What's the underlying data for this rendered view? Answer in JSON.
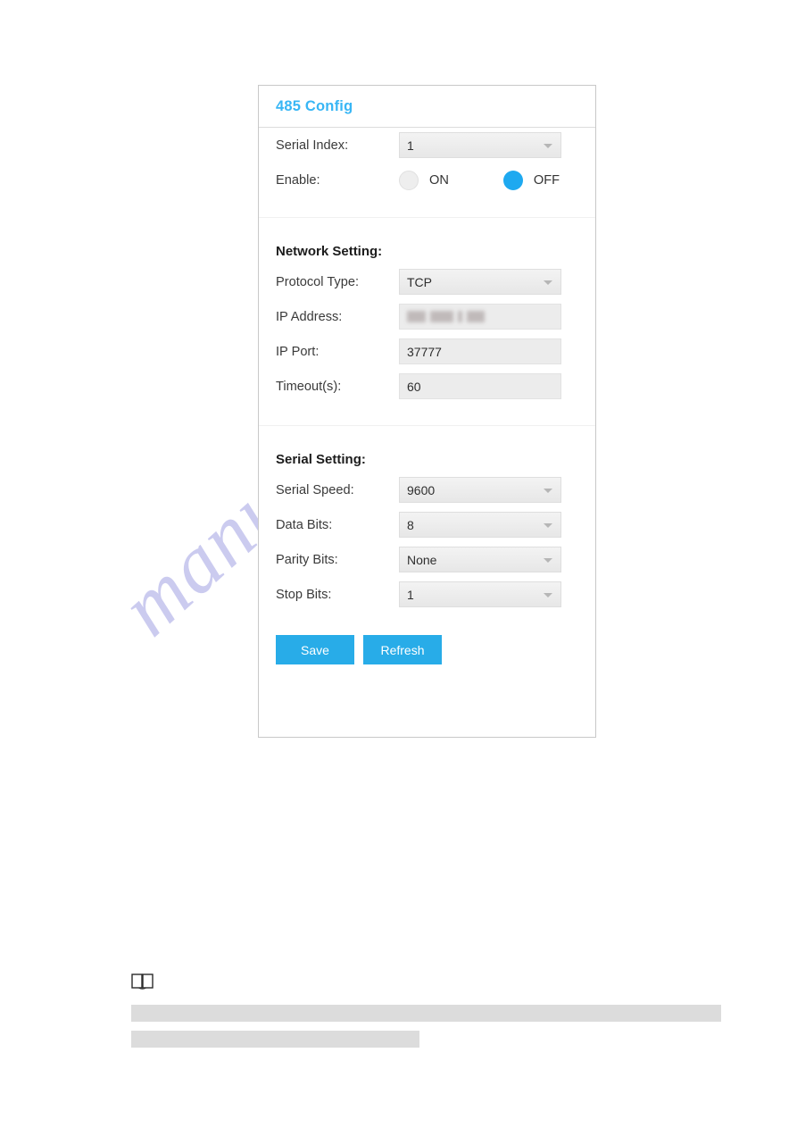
{
  "panel": {
    "title": "485 Config",
    "top_section": {
      "rows": [
        {
          "label": "Serial Index:",
          "value": "1",
          "control": "select"
        }
      ],
      "enable": {
        "label": "Enable:",
        "options": [
          {
            "label": "ON",
            "selected": false
          },
          {
            "label": "OFF",
            "selected": true
          }
        ]
      }
    },
    "network_section": {
      "title": "Network Setting:",
      "rows": [
        {
          "label": "Protocol Type:",
          "value": "TCP",
          "control": "select"
        },
        {
          "label": "IP Address:",
          "value": "",
          "control": "text",
          "redacted": true
        },
        {
          "label": "IP Port:",
          "value": "37777",
          "control": "text"
        },
        {
          "label": "Timeout(s):",
          "value": "60",
          "control": "text"
        }
      ]
    },
    "serial_section": {
      "title": "Serial Setting:",
      "rows": [
        {
          "label": "Serial Speed:",
          "value": "9600",
          "control": "select"
        },
        {
          "label": "Data Bits:",
          "value": "8",
          "control": "select"
        },
        {
          "label": "Parity Bits:",
          "value": "None",
          "control": "select"
        },
        {
          "label": "Stop Bits:",
          "value": "1",
          "control": "select"
        }
      ]
    },
    "buttons": {
      "save": "Save",
      "refresh": "Refresh"
    }
  },
  "note": {
    "icon": "book-icon",
    "bars": [
      "",
      ""
    ]
  },
  "watermark": {
    "text": "manualshive.com"
  },
  "colors": {
    "accent": "#38b6f5",
    "button": "#28ace8",
    "radio_selected": "#1ea9f0",
    "field_bg": "#ececec",
    "panel_border": "#c8c8c8",
    "watermark": "#c9c9ef",
    "gray_bar": "#dcdcdc"
  }
}
